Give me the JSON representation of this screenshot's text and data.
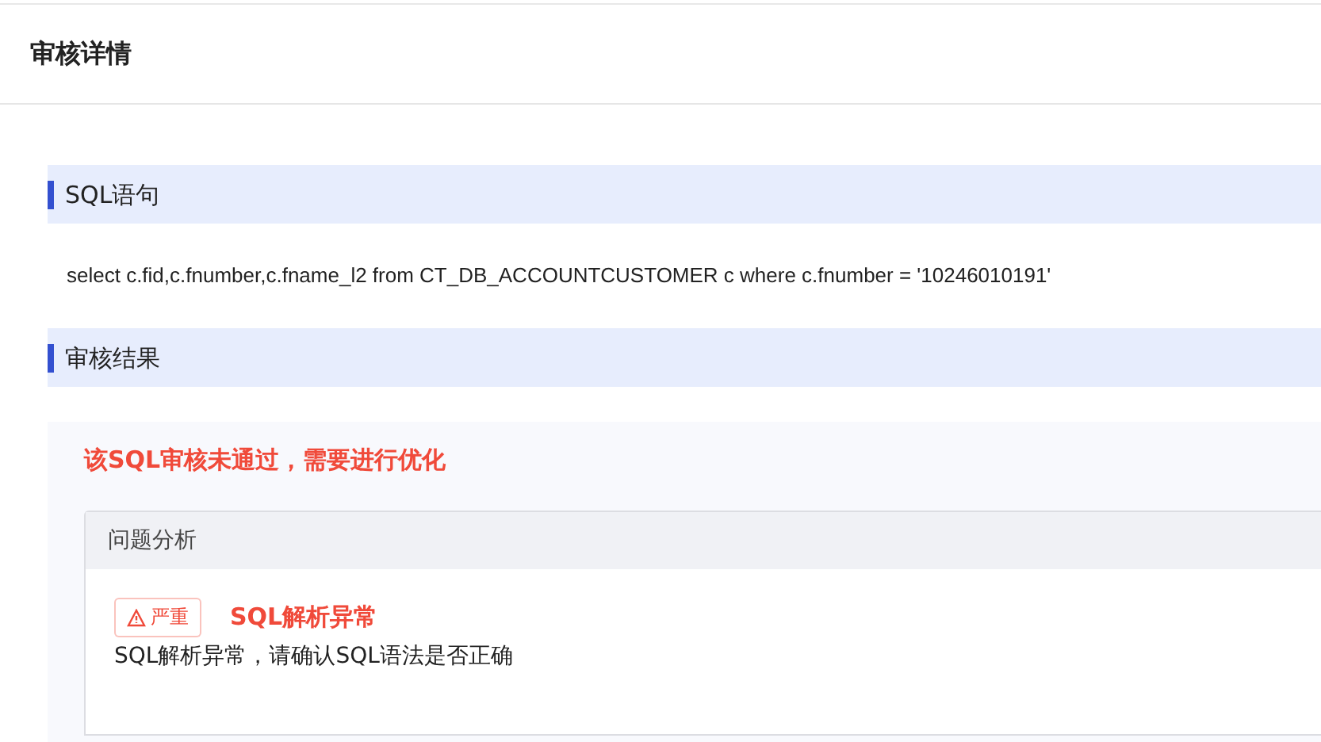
{
  "header": {
    "title": "审核详情"
  },
  "sections": [
    {
      "title": "SQL语句",
      "sql": "select c.fid,c.fnumber,c.fname_l2 from CT_DB_ACCOUNTCUSTOMER c where c.fnumber = '10246010191'"
    },
    {
      "title": "审核结果"
    }
  ],
  "result": {
    "verdict": "该SQL审核未通过，需要进行优化",
    "panel_title": "问题分析",
    "issues": [
      {
        "severity": "严重",
        "color": "#f04a3a",
        "title": "SQL解析异常",
        "description": "SQL解析异常，请确认SQL语法是否正确"
      }
    ]
  }
}
